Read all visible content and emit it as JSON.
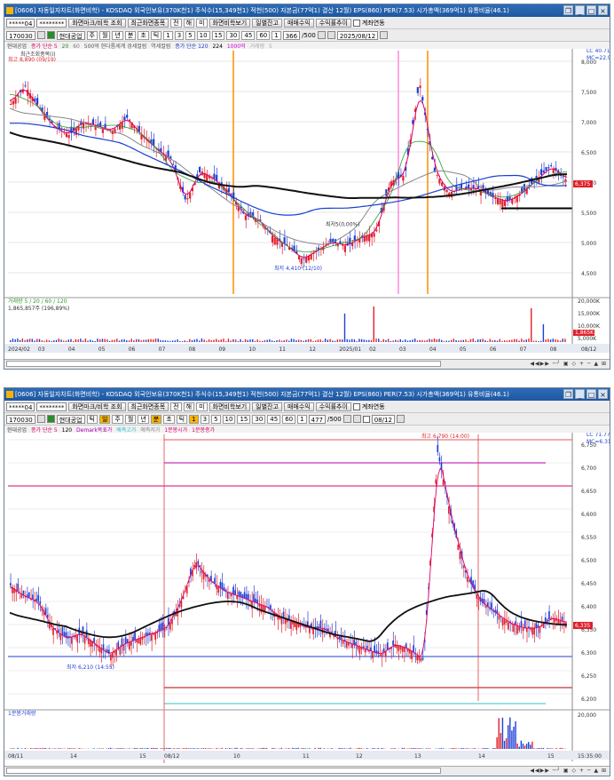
{
  "window1": {
    "title": "[0606] 자동일자차트(화면비학) - KOSDAQ 외국인보유(370K천1) 주식수(15,349천1) 적천(500) 자본금(77억1) 결산 12월) EPS(860) PER(7.53) 시가총액(369억1) 유통비율(46.1)",
    "toolbar": {
      "acct": "*****04",
      "pw": "********",
      "btn_a": "화면마크/비학 조회",
      "btn_b": "최근화면종목",
      "tabs": [
        "전",
        "해",
        "미",
        "화면비학보기"
      ],
      "btn_c": "일별잔고",
      "btn_d": "매매수익",
      "btn_e": "수익률추이",
      "check": "계좌연동"
    },
    "toolbar2": {
      "code": "170030",
      "name": "현대공업",
      "periods": [
        "주",
        "월",
        "년",
        "분",
        "초",
        "틱"
      ],
      "mins": [
        "1",
        "3",
        "5",
        "10",
        "15",
        "30",
        "45",
        "60",
        "1"
      ],
      "count": "366",
      "total": "/500",
      "date": "2025/08/12"
    },
    "legend": [
      "현대공업",
      "종가 단순 5",
      "20",
      "60",
      "500억 현다툼세계 경세컬럼",
      "역세컬럼",
      "종가 단순 120",
      "224",
      "1000억",
      "거래량",
      "5"
    ],
    "legend_label": "최근조회종목(i)",
    "high_label": "최고 8,890 (09/19)",
    "low_label": "최저 4,410 (12/10)",
    "mid_label": "최저5(0,00%)",
    "right_top": [
      "LC 40.71",
      "MC=22.90"
    ],
    "y_ticks": [
      "8,000",
      "7,500",
      "7,000",
      "6,500",
      "6,000",
      "5,500",
      "5,000",
      "4,500"
    ],
    "volume_legend": "거래량 5 / 20 / 60 / 120",
    "volume_label": "1,865,857주 (196,89%)",
    "vol_ticks": [
      "20,000K",
      "15,000K",
      "10,000K",
      "5,000K"
    ],
    "x_ticks": [
      "2024/02",
      "03",
      "04",
      "05",
      "06",
      "07",
      "08",
      "09",
      "10",
      "11",
      "12",
      "2025/01",
      "02",
      "03",
      "04",
      "05",
      "06",
      "07",
      "08"
    ],
    "price_tag": "6,375",
    "vol_tag": "1,865K",
    "corner": "08/12"
  },
  "window2": {
    "title": "[0606] 자동일자차트(화면비학) - KOSDAQ 외국인보유(370K천1) 주식수(15,349천1) 적천(500) 자본금(77억1) 결산 12월) EPS(860) PER(7.53) 시가총액(369억1) 유통비율(46.1)",
    "toolbar": {
      "acct": "*****04",
      "pw": "********",
      "btn_a": "화면마크/비학 조회",
      "btn_b": "최근화면종목",
      "tabs": [
        "전",
        "해",
        "미",
        "화면비학보기"
      ],
      "btn_c": "일별잔고",
      "btn_d": "매매수익",
      "btn_e": "수익률추이",
      "check": "계좌연동"
    },
    "toolbar2": {
      "code": "170030",
      "name": "현대공업",
      "periods": [
        "틱",
        "일",
        "주",
        "월",
        "년",
        "분",
        "초",
        "틱"
      ],
      "mins": [
        "1",
        "3",
        "5",
        "10",
        "15",
        "30",
        "45",
        "60",
        "1"
      ],
      "count": "477",
      "total": "/500",
      "date": "08/12"
    },
    "legend": [
      "현대공업",
      "종가 단순 5",
      "120",
      "Demark목표가",
      "예측고가",
      "예측저가",
      "1분봉시가",
      "1분봉종가"
    ],
    "high_label": "최고 6,790 (14:00)",
    "low_label": "최저 6,210 (14:55)",
    "right_top": [
      "LC 71.77",
      "MC=6.31"
    ],
    "y_ticks": [
      "6,750",
      "6,700",
      "6,650",
      "6,600",
      "6,550",
      "6,500",
      "6,450",
      "6,400",
      "6,350",
      "6,300",
      "6,250",
      "6,200"
    ],
    "volume_legend": "1분봉거래량",
    "vol_ticks": [
      "20,000"
    ],
    "x_ticks": [
      "08/11",
      "14",
      "15",
      "08/12",
      "10",
      "11",
      "12",
      "13",
      "14",
      "15"
    ],
    "price_tag": "6,335",
    "corner": "15:35:00"
  }
}
